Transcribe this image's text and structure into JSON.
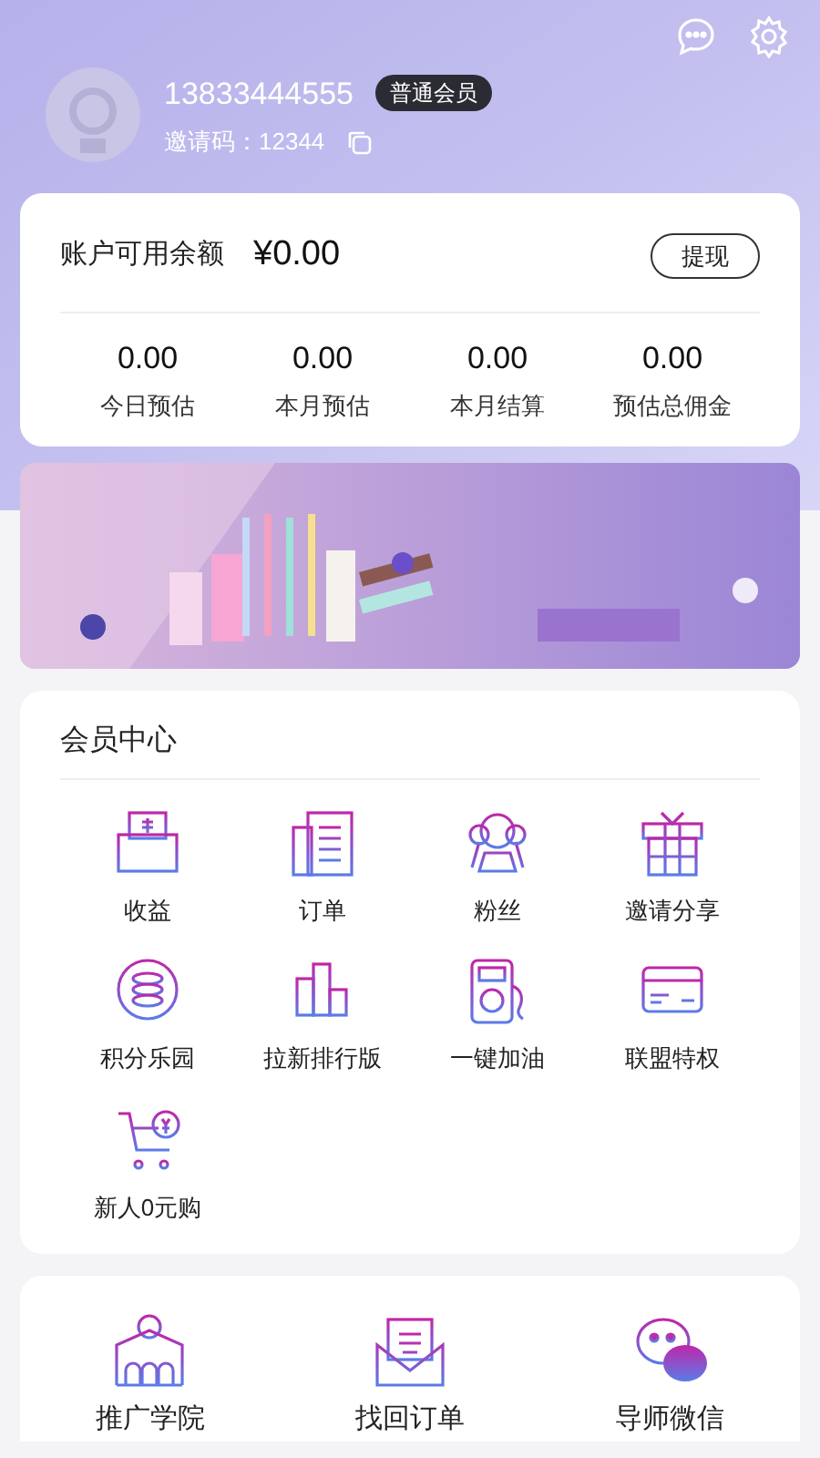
{
  "profile": {
    "phone": "13833444555",
    "badge": "普通会员",
    "invite_code": "邀请码：12344"
  },
  "balance": {
    "label": "账户可用余额",
    "amount": "¥0.00",
    "withdraw": "提现",
    "stats": [
      {
        "value": "0.00",
        "label": "今日预估"
      },
      {
        "value": "0.00",
        "label": "本月预估"
      },
      {
        "value": "0.00",
        "label": "本月结算"
      },
      {
        "value": "0.00",
        "label": "预估总佣金"
      }
    ]
  },
  "banner": {
    "kind": "picture"
  },
  "member_center": {
    "title": "会员中心",
    "items": [
      "收益",
      "订单",
      "粉丝",
      "邀请分享",
      "积分乐园",
      "拉新排行版",
      "一键加油",
      "联盟特权",
      "新人0元购"
    ]
  },
  "tools": [
    "推广学院",
    "找回订单",
    "导师微信"
  ]
}
